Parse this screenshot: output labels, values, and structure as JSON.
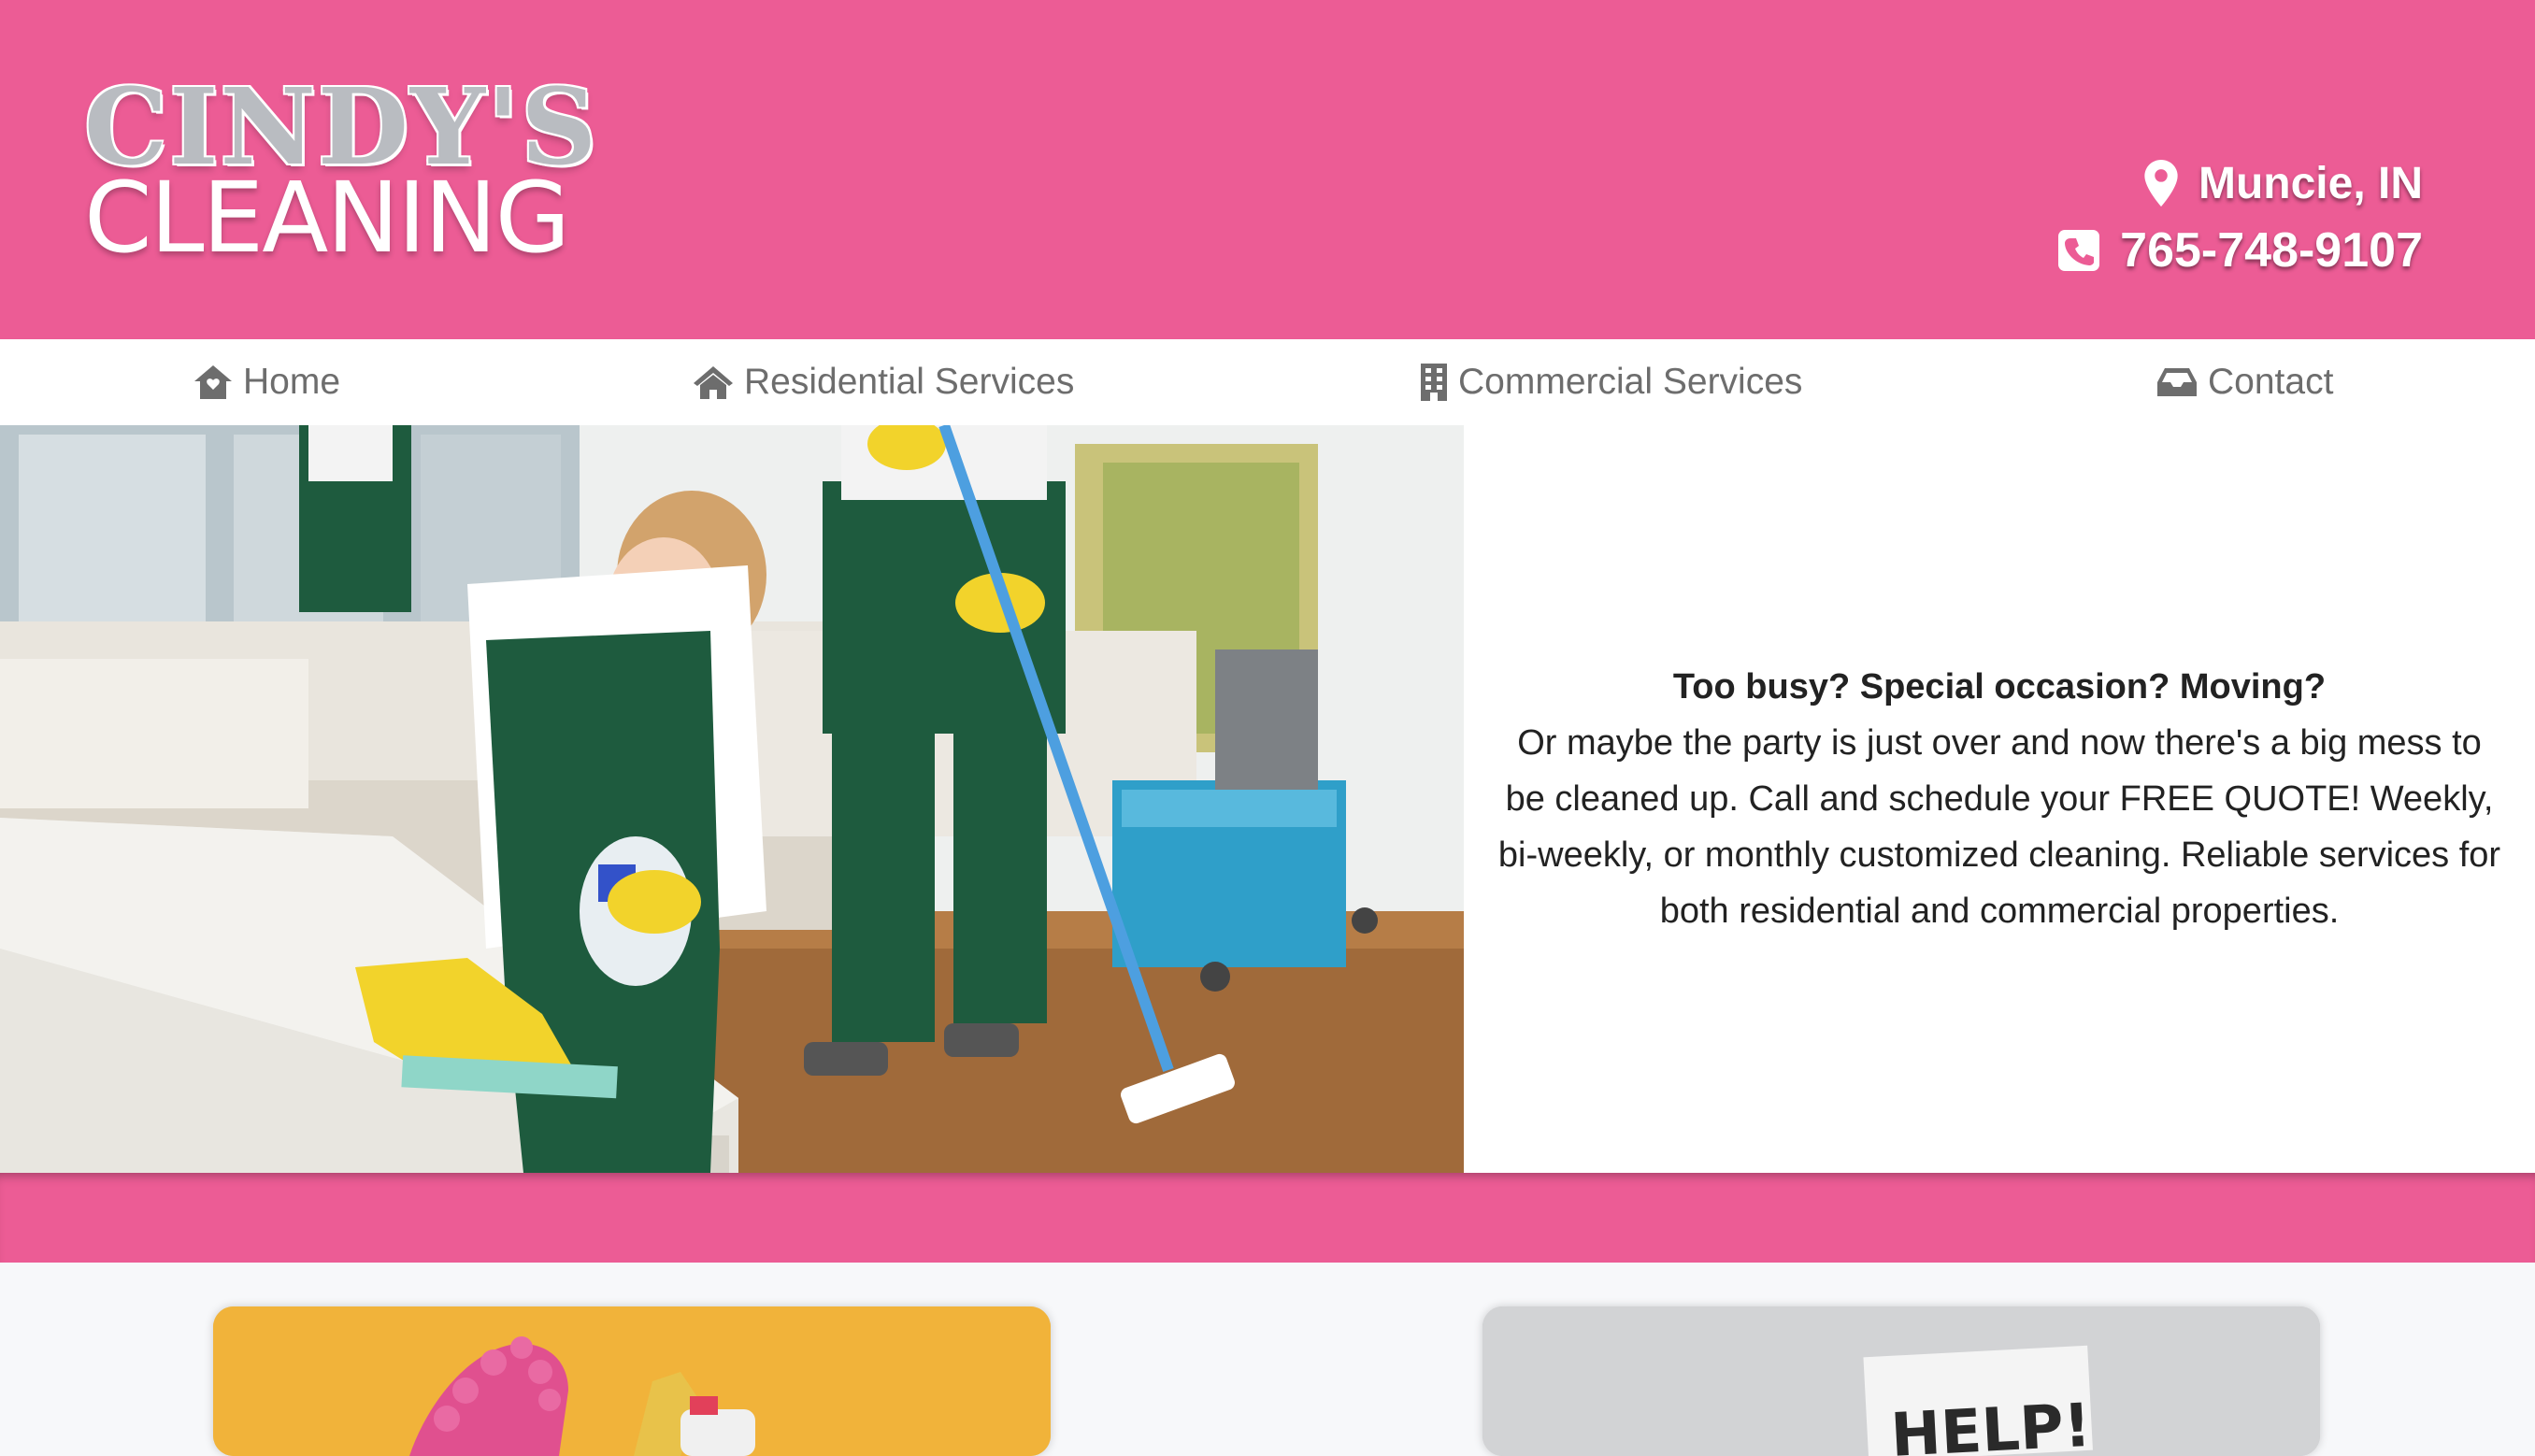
{
  "header": {
    "logo_top": "CINDY'S",
    "logo_bottom": "CLEANING",
    "location": "Muncie, IN",
    "phone": "765-748-9107",
    "location_icon": "map-pin-icon",
    "phone_icon": "phone-square-icon"
  },
  "nav": {
    "items": [
      {
        "label": "Home",
        "icon": "home-icon"
      },
      {
        "label": "Residential Services",
        "icon": "house-icon"
      },
      {
        "label": "Commercial Services",
        "icon": "building-icon"
      },
      {
        "label": "Contact",
        "icon": "inbox-icon"
      }
    ]
  },
  "hero": {
    "title": "Too busy? Special occasion? Moving?",
    "body": "Or maybe the party is just over and now there's a big mess to be cleaned up. Call and schedule your FREE QUOTE! Weekly, bi-weekly, or monthly customized cleaning. Reliable services for both residential and commercial properties."
  },
  "cards": {
    "right_sign_text": "HELP!"
  },
  "colors": {
    "brand_pink": "#ec5c95",
    "nav_text": "#6d6d6d",
    "body_text": "#222222"
  }
}
